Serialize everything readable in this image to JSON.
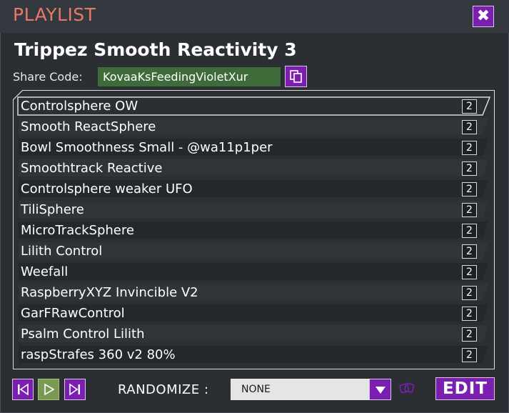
{
  "header": {
    "title": "PLAYLIST",
    "close_icon": "close-icon"
  },
  "playlist": {
    "name": "Trippez Smooth Reactivity 3",
    "share_label": "Share Code:",
    "share_code": "KovaaKsFeedingVioletXur",
    "copy_icon": "copy-icon"
  },
  "scenarios": [
    {
      "label": "Controlsphere OW",
      "count": "2",
      "selected": true
    },
    {
      "label": "Smooth ReactSphere",
      "count": "2"
    },
    {
      "label": "Bowl Smoothness Small - @wa11p1per",
      "count": "2"
    },
    {
      "label": "Smoothtrack Reactive",
      "count": "2"
    },
    {
      "label": "Controlsphere weaker UFO",
      "count": "2"
    },
    {
      "label": "TiliSphere",
      "count": "2"
    },
    {
      "label": "MicroTrackSphere",
      "count": "2"
    },
    {
      "label": "Lilith Control",
      "count": "2"
    },
    {
      "label": "Weefall",
      "count": "2"
    },
    {
      "label": "RaspberryXYZ Invincible V2",
      "count": "2"
    },
    {
      "label": "GarFRawControl",
      "count": "2"
    },
    {
      "label": "Psalm Control Lilith",
      "count": "2"
    },
    {
      "label": "raspStrafes 360 v2 80%",
      "count": "2"
    }
  ],
  "controls": {
    "randomize_label": "RANDOMIZE :",
    "randomize_value": "NONE",
    "edit_label": "EDIT"
  },
  "colors": {
    "accent_purple": "#7a1fb0",
    "title_color": "#e77966",
    "share_code_bg": "#3f6b3a",
    "play_green": "#7a9a52"
  }
}
